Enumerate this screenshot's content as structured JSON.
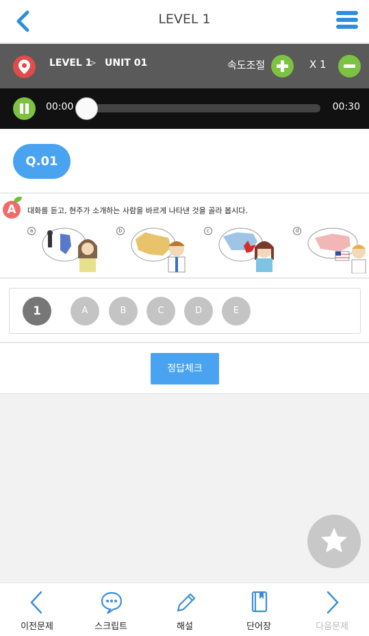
{
  "header": {
    "title": "LEVEL 1"
  },
  "breadcrumb": {
    "level": "LEVEL 1",
    "separator": ">",
    "unit": "UNIT 01"
  },
  "speed": {
    "label": "속도조절",
    "value": "X 1"
  },
  "player": {
    "current_time": "00:00",
    "total_time": "00:30",
    "progress": 0
  },
  "question": {
    "number": "Q.01",
    "marker": "A",
    "prompt": "대화를 듣고, 현주가 소개하는 사람을 바르게 나타낸 것을 골라 봅시다.",
    "options": [
      "a",
      "b",
      "c",
      "d"
    ]
  },
  "answer": {
    "number": "1",
    "choices": [
      "A",
      "B",
      "C",
      "D",
      "E"
    ]
  },
  "check_button": "정답체크",
  "nav": {
    "prev": "이전문제",
    "script": "스크립트",
    "explain": "해설",
    "vocab": "단어장",
    "next": "다음문제"
  },
  "colors": {
    "accent": "#4aa3f0",
    "green": "#7dc242",
    "pin": "#e24b4b"
  }
}
